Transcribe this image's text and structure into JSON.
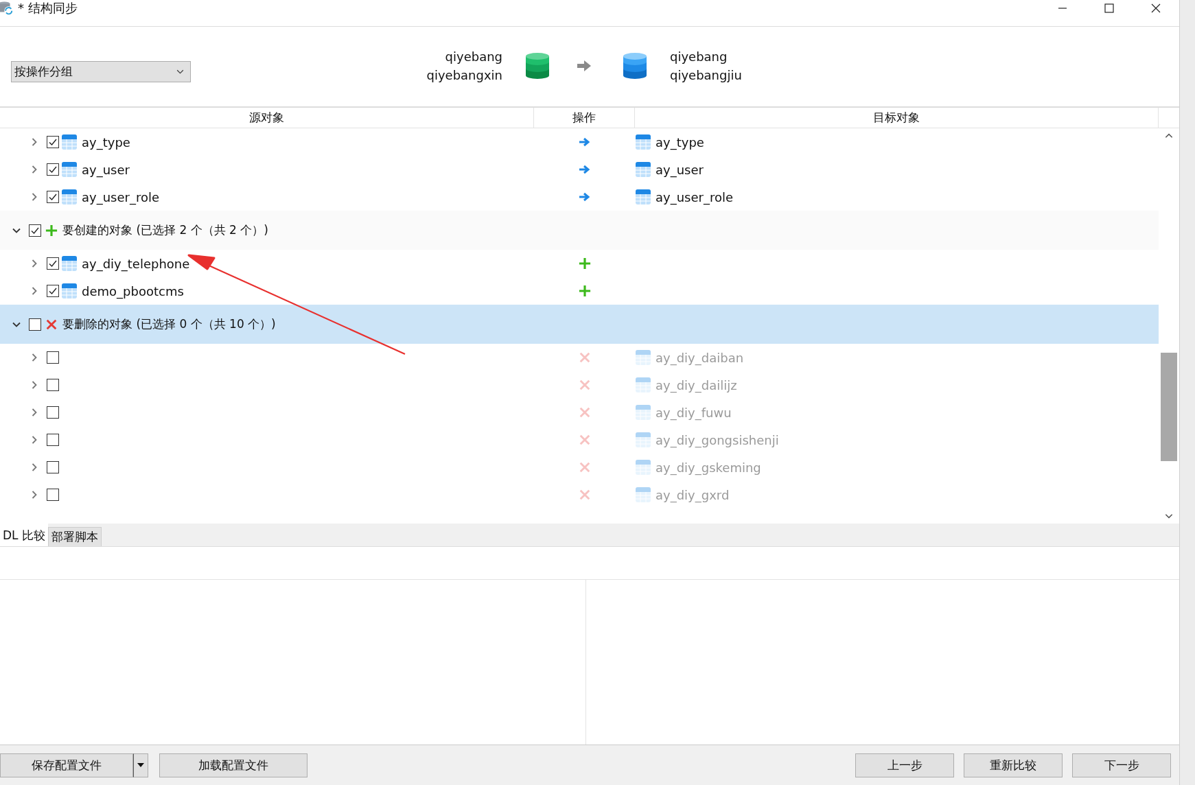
{
  "window": {
    "title": "* 结构同步"
  },
  "grouping": {
    "value": "按操作分组"
  },
  "source": {
    "server": "qiyebang",
    "database": "qiyebangxin"
  },
  "target": {
    "server": "qiyebang",
    "database": "qiyebangjiu"
  },
  "columns": [
    "源对象",
    "操作",
    "目标对象"
  ],
  "tree": [
    {
      "kind": "update",
      "source": "ay_type",
      "target": "ay_type",
      "checked": true,
      "expanded": false,
      "selected": false,
      "disabled": false
    },
    {
      "kind": "update",
      "source": "ay_user",
      "target": "ay_user",
      "checked": true,
      "expanded": false,
      "selected": false,
      "disabled": false
    },
    {
      "kind": "update",
      "source": "ay_user_role",
      "target": "ay_user_role",
      "checked": true,
      "expanded": false,
      "selected": false,
      "disabled": false
    },
    {
      "kind": "group",
      "label": "要创建的对象 (已选择 2 个（共 2 个）)",
      "group_icon": {
        "kind": "create"
      },
      "checked": true,
      "expanded": true,
      "selected": false,
      "children": [
        {
          "kind": "create",
          "source": "ay_diy_telephone",
          "checked": true,
          "expanded": false,
          "selected": false,
          "disabled": false
        },
        {
          "kind": "create",
          "source": "demo_pbootcms",
          "checked": true,
          "expanded": false,
          "selected": false,
          "disabled": false
        }
      ]
    },
    {
      "kind": "group",
      "label": "要删除的对象 (已选择 0 个（共 10 个）)",
      "group_icon": {
        "kind": "delete"
      },
      "checked": false,
      "expanded": true,
      "selected": true,
      "children": [
        {
          "kind": "delete",
          "target": "ay_diy_daiban",
          "checked": false,
          "expanded": false,
          "selected": false,
          "disabled": true
        },
        {
          "kind": "delete",
          "target": "ay_diy_dailijz",
          "checked": false,
          "expanded": false,
          "selected": false,
          "disabled": true
        },
        {
          "kind": "delete",
          "target": "ay_diy_fuwu",
          "checked": false,
          "expanded": false,
          "selected": false,
          "disabled": true
        },
        {
          "kind": "delete",
          "target": "ay_diy_gongsishenji",
          "checked": false,
          "expanded": false,
          "selected": false,
          "disabled": true
        },
        {
          "kind": "delete",
          "target": "ay_diy_gskeming",
          "checked": false,
          "expanded": false,
          "selected": false,
          "disabled": true
        },
        {
          "kind": "delete",
          "target": "ay_diy_gxrd",
          "checked": false,
          "expanded": false,
          "selected": false,
          "disabled": true
        }
      ]
    }
  ],
  "bottom_tabs": [
    {
      "label": "DL 比较",
      "selected": true
    },
    {
      "label": "部署脚本",
      "selected": false
    }
  ],
  "footer": {
    "left_buttons": [
      "保存配置文件",
      "加载配置文件"
    ],
    "right_buttons": [
      "上一步",
      "重新比较",
      "下一步"
    ]
  }
}
